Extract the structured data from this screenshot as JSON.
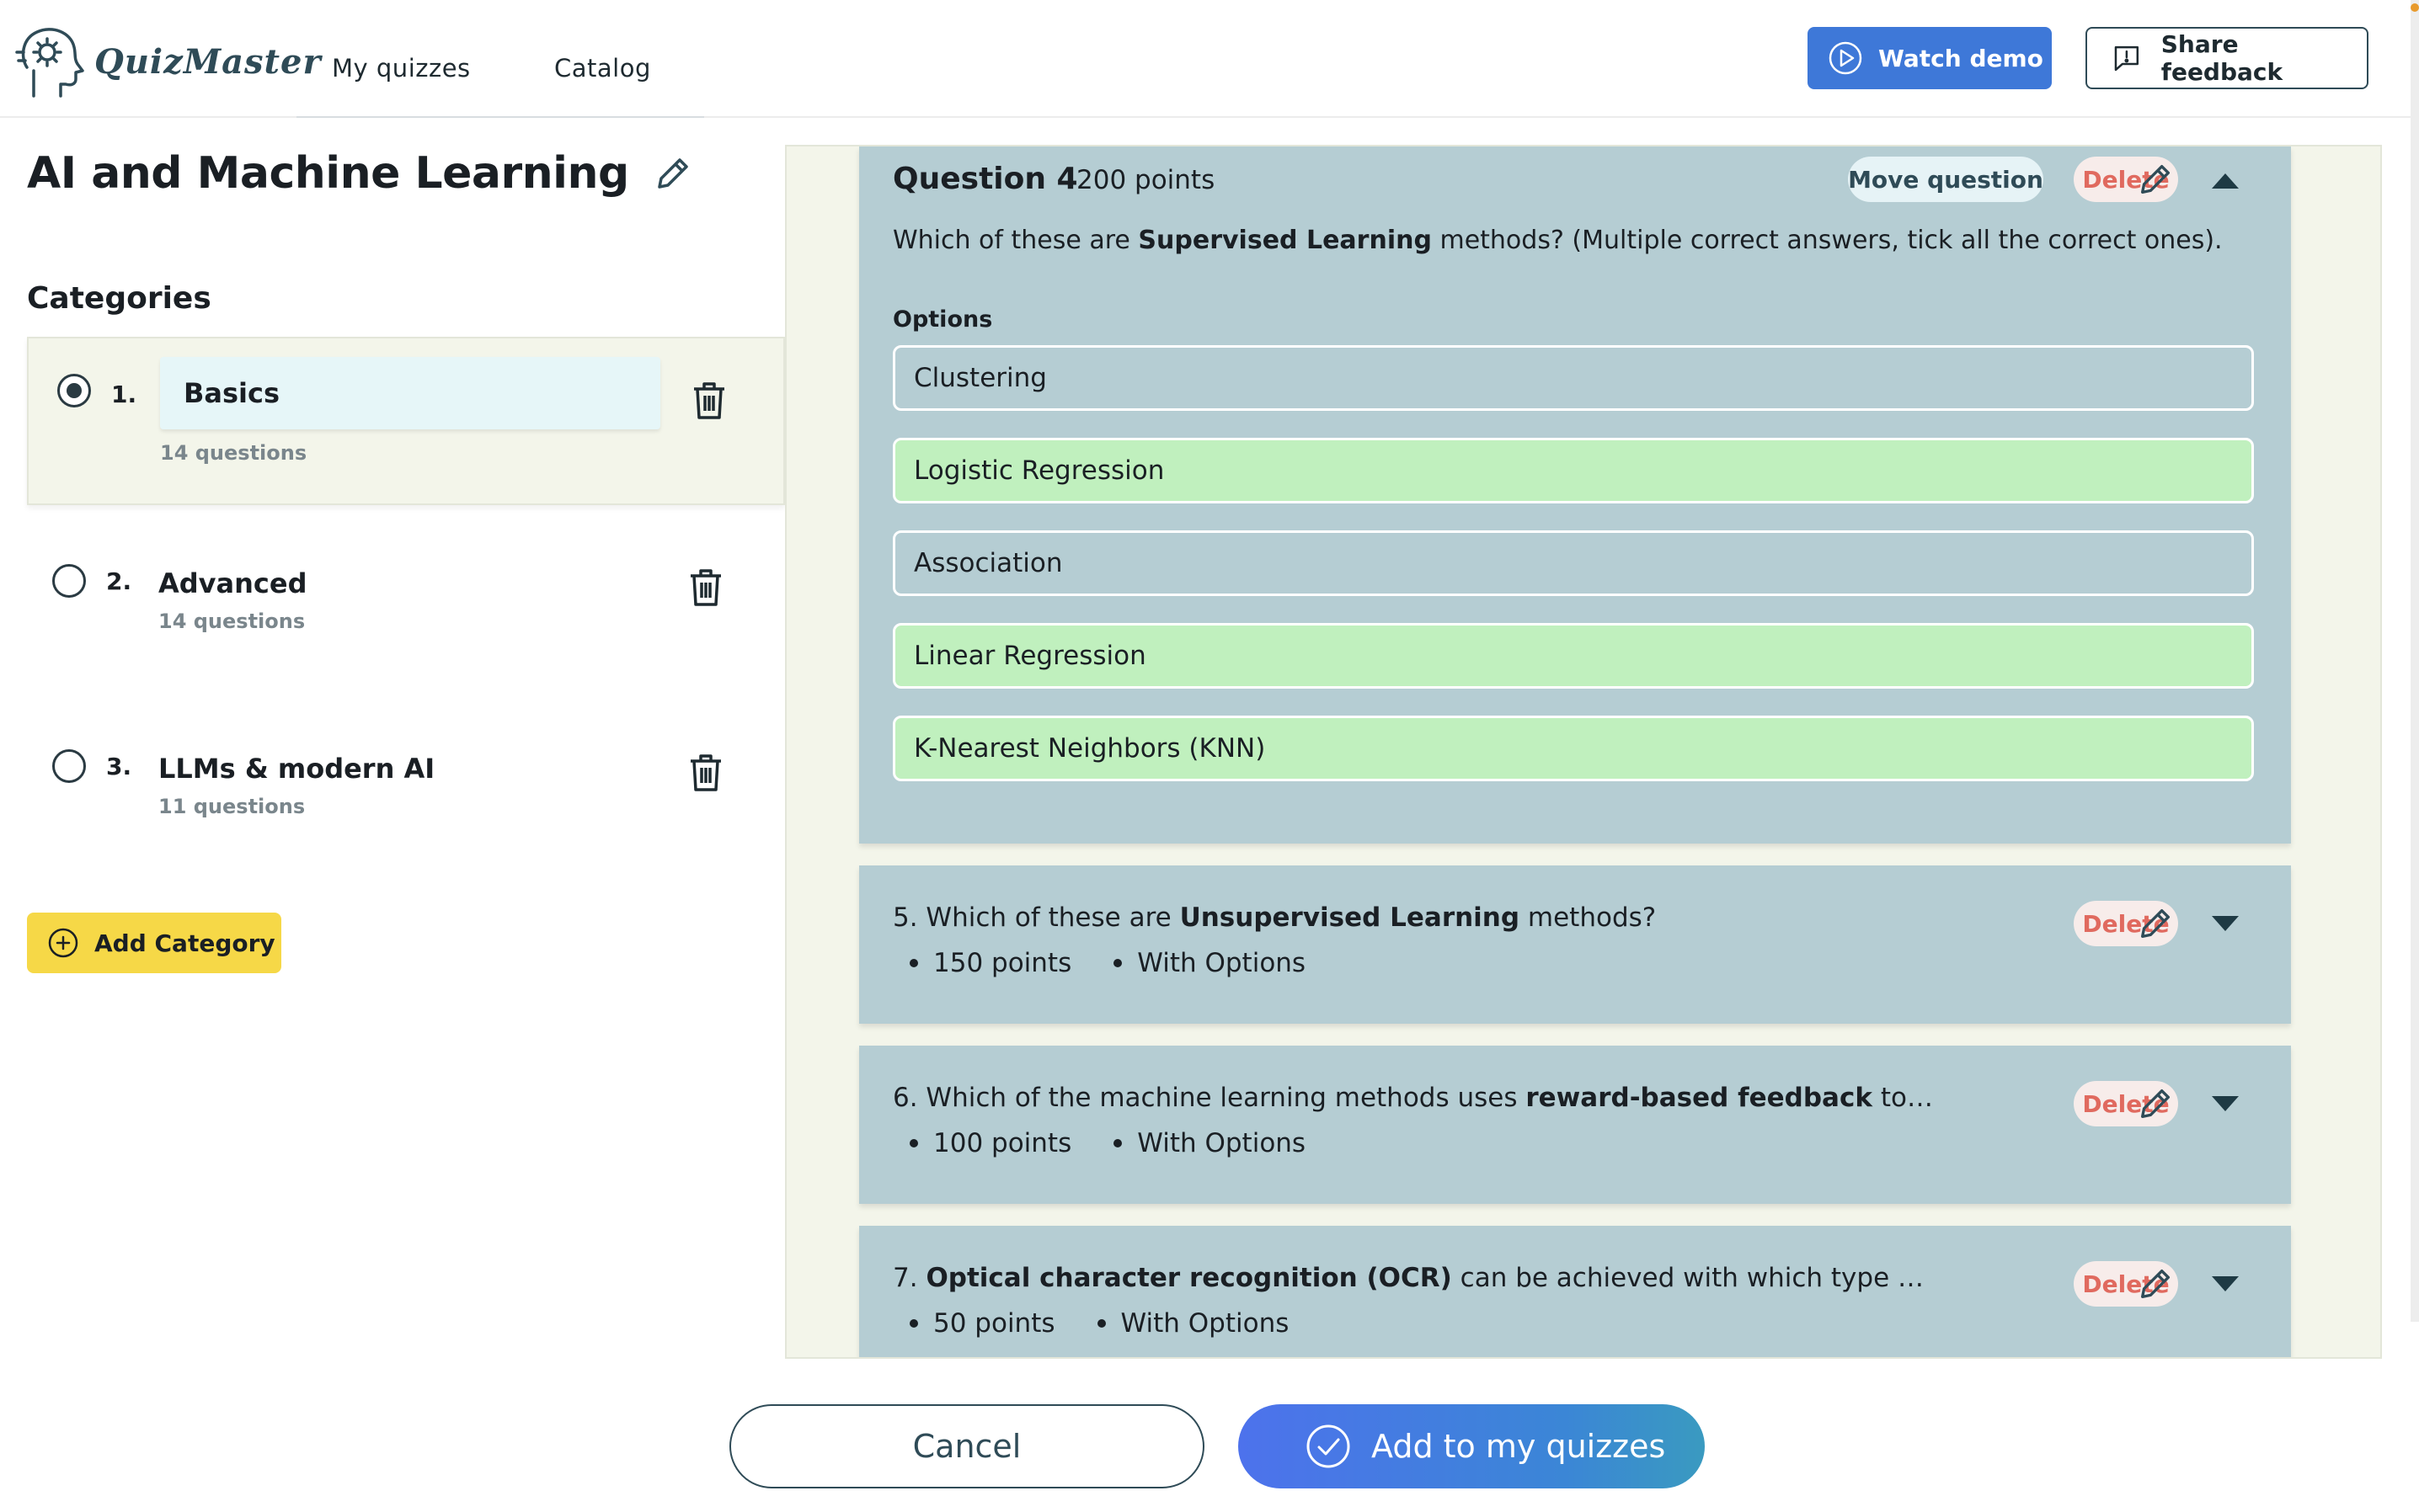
{
  "app": {
    "name": "QuizMaster"
  },
  "nav": {
    "my_quizzes": "My quizzes",
    "catalog": "Catalog"
  },
  "header": {
    "watch_demo": "Watch demo",
    "share_feedback": "Share feedback"
  },
  "quiz": {
    "title": "AI and Machine Learning"
  },
  "categories": {
    "heading": "Categories",
    "items": [
      {
        "num": "1.",
        "name": "Basics",
        "count": "14 questions",
        "selected": true
      },
      {
        "num": "2.",
        "name": "Advanced",
        "count": "14 questions",
        "selected": false
      },
      {
        "num": "3.",
        "name": "LLMs & modern AI",
        "count": "11 questions",
        "selected": false
      }
    ],
    "add_label": "Add Category"
  },
  "questions": {
    "expanded": {
      "title": "Question 4",
      "points": "200 points",
      "move_label": "Move question",
      "delete_label": "Delete",
      "text_before": "Which of these are ",
      "text_bold": "Supervised Learning",
      "text_after": " methods? (Multiple correct answers, tick all the correct ones).",
      "options_label": "Options",
      "options": [
        {
          "text": "Clustering",
          "correct": false
        },
        {
          "text": "Logistic Regression",
          "correct": true
        },
        {
          "text": "Association",
          "correct": false
        },
        {
          "text": "Linear Regression",
          "correct": true
        },
        {
          "text": "K-Nearest Neighbors (KNN)",
          "correct": true
        }
      ]
    },
    "collapsed": [
      {
        "prefix": "5. Which of these are ",
        "bold": "Unsupervised Learning",
        "suffix": " methods?",
        "points": "150 points",
        "type": "With Options",
        "delete_label": "Delete"
      },
      {
        "prefix": "6. Which of the machine learning methods uses ",
        "bold": "reward-based feedback",
        "suffix": " to learn a…",
        "points": "100 points",
        "type": "With Options",
        "delete_label": "Delete"
      },
      {
        "prefix": "7. ",
        "bold": "Optical character recognition (OCR)",
        "suffix": " can be achieved with which type of Machine…",
        "points": "50 points",
        "type": "With Options",
        "delete_label": "Delete"
      }
    ]
  },
  "footer": {
    "cancel": "Cancel",
    "add": "Add to my quizzes"
  },
  "colors": {
    "primary_blue": "#3e78d8",
    "card_bg": "#b5cdd3",
    "correct_bg": "#c0f0be",
    "delete_red": "#e06a5f",
    "add_yellow": "#f6d847",
    "panel_bg": "#f3f5ea"
  },
  "icons": {
    "logo": "head-gear-icon",
    "demo": "play-circle-icon",
    "feedback": "feedback-icon",
    "edit": "pencil-icon",
    "delete": "trash-icon",
    "add": "plus-circle-icon",
    "expand": "chevron-down-icon",
    "collapse": "chevron-up-icon",
    "confirm": "check-circle-icon"
  }
}
